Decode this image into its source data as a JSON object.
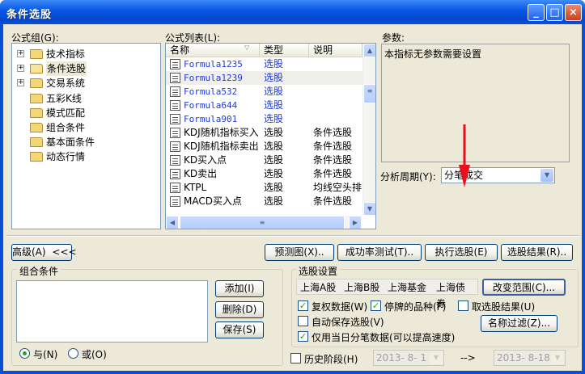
{
  "window": {
    "title": "条件选股",
    "minimize": "_",
    "maximize": "□",
    "close": "×"
  },
  "formula_group": {
    "label": "公式组(G):",
    "items": [
      {
        "label": "技术指标",
        "expandable": true,
        "expander": "+"
      },
      {
        "label": "条件选股",
        "expandable": true,
        "expander": "+"
      },
      {
        "label": "交易系统",
        "expandable": true,
        "expander": "+"
      },
      {
        "label": "五彩K线",
        "expandable": false
      },
      {
        "label": "模式匹配",
        "expandable": false
      },
      {
        "label": "组合条件",
        "expandable": false
      },
      {
        "label": "基本面条件",
        "expandable": false
      },
      {
        "label": "动态行情",
        "expandable": false
      }
    ]
  },
  "formula_list": {
    "label": "公式列表(L):",
    "columns": [
      "名称",
      "类型",
      "说明"
    ],
    "rows": [
      {
        "name": "Formula1235",
        "type": "选股",
        "desc": "",
        "custom": true
      },
      {
        "name": "Formula1239",
        "type": "选股",
        "desc": "",
        "custom": true,
        "selected": true
      },
      {
        "name": "Formula532",
        "type": "选股",
        "desc": "",
        "custom": true
      },
      {
        "name": "Formula644",
        "type": "选股",
        "desc": "",
        "custom": true
      },
      {
        "name": "Formula901",
        "type": "选股",
        "desc": "",
        "custom": true
      },
      {
        "name": "KDJ随机指标买入",
        "type": "选股",
        "desc": "条件选股",
        "custom": false
      },
      {
        "name": "KDJ随机指标卖出",
        "type": "选股",
        "desc": "条件选股",
        "custom": false
      },
      {
        "name": "KD买入点",
        "type": "选股",
        "desc": "条件选股",
        "custom": false
      },
      {
        "name": "KD卖出",
        "type": "选股",
        "desc": "条件选股",
        "custom": false
      },
      {
        "name": "KTPL",
        "type": "选股",
        "desc": "均线空头排",
        "custom": false
      },
      {
        "name": "MACD买入点",
        "type": "选股",
        "desc": "条件选股",
        "custom": false
      }
    ]
  },
  "params": {
    "label": "参数:",
    "text": "本指标无参数需要设置"
  },
  "period": {
    "label": "分析周期(Y):",
    "value": "分笔成交"
  },
  "actions": {
    "advanced": "高级(A)",
    "advanced_arrow": "<<<",
    "preview": "预测图(X)..",
    "success_test": "成功率测试(T)..",
    "run": "执行选股(E)",
    "result": "选股结果(R).."
  },
  "combo_conditions": {
    "label": "组合条件",
    "add": "添加(I)",
    "delete": "删除(D)",
    "save": "保存(S)",
    "and_label": "与(N)",
    "or_label": "或(O)",
    "and_selected": true
  },
  "stock_settings": {
    "label": "选股设置",
    "markets": [
      "上海A股",
      "上海B股",
      "上海基金",
      "上海债券"
    ],
    "change_range": "改变范围(C)...",
    "adjusted": "复权数据(W)",
    "adjusted_checked": true,
    "suspended": "停牌的品种(F)",
    "suspended_checked": true,
    "deselect": "取选股结果(U)",
    "deselect_checked": false,
    "autosave": "自动保存选股(V)",
    "autosave_checked": false,
    "today_only": "仅用当日分笔数据(可以提高速度)",
    "today_only_checked": true,
    "name_filter": "名称过滤(Z)..."
  },
  "history": {
    "label": "历史阶段(H)",
    "checked": false,
    "from": "2013- 8- 1",
    "arrow": "-->",
    "to": "2013- 8-18"
  },
  "colors": {
    "title_blue": "#0a4fd6",
    "formula_blue": "#1f3bd6",
    "dialog_bg": "#ece9d8",
    "annotation_red": "#e8101a"
  }
}
